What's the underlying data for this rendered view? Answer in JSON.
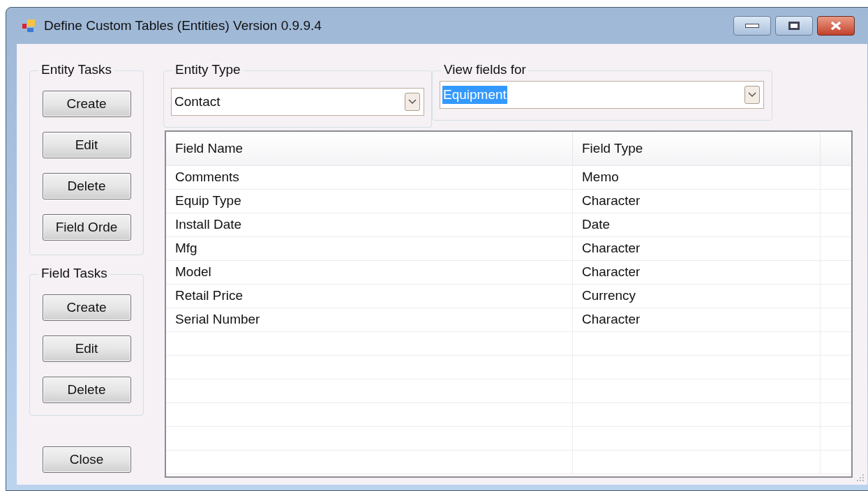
{
  "window": {
    "title": "Define Custom Tables (Entities) Version 0.9.9.4"
  },
  "entity_tasks": {
    "title": "Entity Tasks",
    "buttons": [
      "Create",
      "Edit",
      "Delete",
      "Field Orde"
    ]
  },
  "field_tasks": {
    "title": "Field Tasks",
    "buttons": [
      "Create",
      "Edit",
      "Delete"
    ]
  },
  "close_button": "Close",
  "entity_type": {
    "title": "Entity Type",
    "value": "Contact"
  },
  "view_fields_for": {
    "title": "View fields for",
    "value": "Equipment",
    "selected": true
  },
  "table": {
    "columns": [
      "Field Name",
      "Field Type"
    ],
    "rows": [
      [
        "Comments",
        "Memo"
      ],
      [
        "Equip Type",
        "Character"
      ],
      [
        "Install Date",
        "Date"
      ],
      [
        "Mfg",
        "Character"
      ],
      [
        "Model",
        "Character"
      ],
      [
        "Retail Price",
        "Currency"
      ],
      [
        "Serial Number",
        "Character"
      ]
    ]
  }
}
